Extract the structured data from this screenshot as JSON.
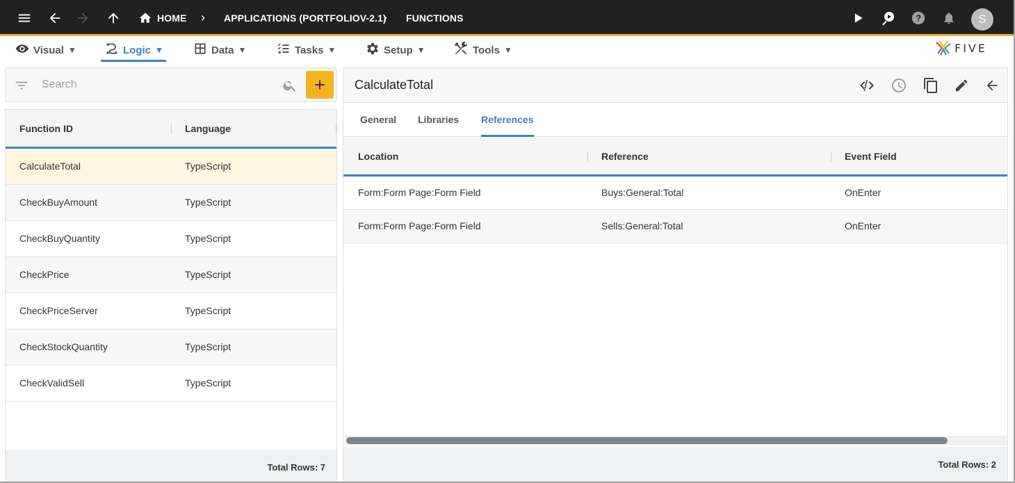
{
  "topbar": {
    "breadcrumbs": [
      "HOME",
      "APPLICATIONS (PORTFOLIOV-2.1)",
      "FUNCTIONS"
    ],
    "avatar_initial": "S",
    "accent_color": "#f5b324"
  },
  "menu": {
    "items": [
      {
        "label": "Visual",
        "icon": "eye-icon"
      },
      {
        "label": "Logic",
        "icon": "logic-icon",
        "active": true
      },
      {
        "label": "Data",
        "icon": "table-icon"
      },
      {
        "label": "Tasks",
        "icon": "checklist-icon"
      },
      {
        "label": "Setup",
        "icon": "gear-icon"
      },
      {
        "label": "Tools",
        "icon": "tools-icon"
      }
    ],
    "active_color": "#3f7fc5"
  },
  "logo": {
    "text": "FIVE"
  },
  "left": {
    "search_placeholder": "Search",
    "columns": [
      "Function ID",
      "Language"
    ],
    "rows": [
      {
        "id": "CalculateTotal",
        "language": "TypeScript",
        "selected": true
      },
      {
        "id": "CheckBuyAmount",
        "language": "TypeScript"
      },
      {
        "id": "CheckBuyQuantity",
        "language": "TypeScript"
      },
      {
        "id": "CheckPrice",
        "language": "TypeScript"
      },
      {
        "id": "CheckPriceServer",
        "language": "TypeScript"
      },
      {
        "id": "CheckStockQuantity",
        "language": "TypeScript"
      },
      {
        "id": "CheckValidSell",
        "language": "TypeScript"
      }
    ],
    "total_rows": "Total Rows: 7"
  },
  "right": {
    "title": "CalculateTotal",
    "tabs": [
      "General",
      "Libraries",
      "References"
    ],
    "active_tab": "References",
    "columns": [
      "Location",
      "Reference",
      "Event Field"
    ],
    "rows": [
      {
        "location": "Form:Form Page:Form Field",
        "reference": "Buys:General:Total",
        "event_field": "OnEnter"
      },
      {
        "location": "Form:Form Page:Form Field",
        "reference": "Sells:General:Total",
        "event_field": "OnEnter"
      }
    ],
    "total_rows": "Total Rows: 2"
  }
}
